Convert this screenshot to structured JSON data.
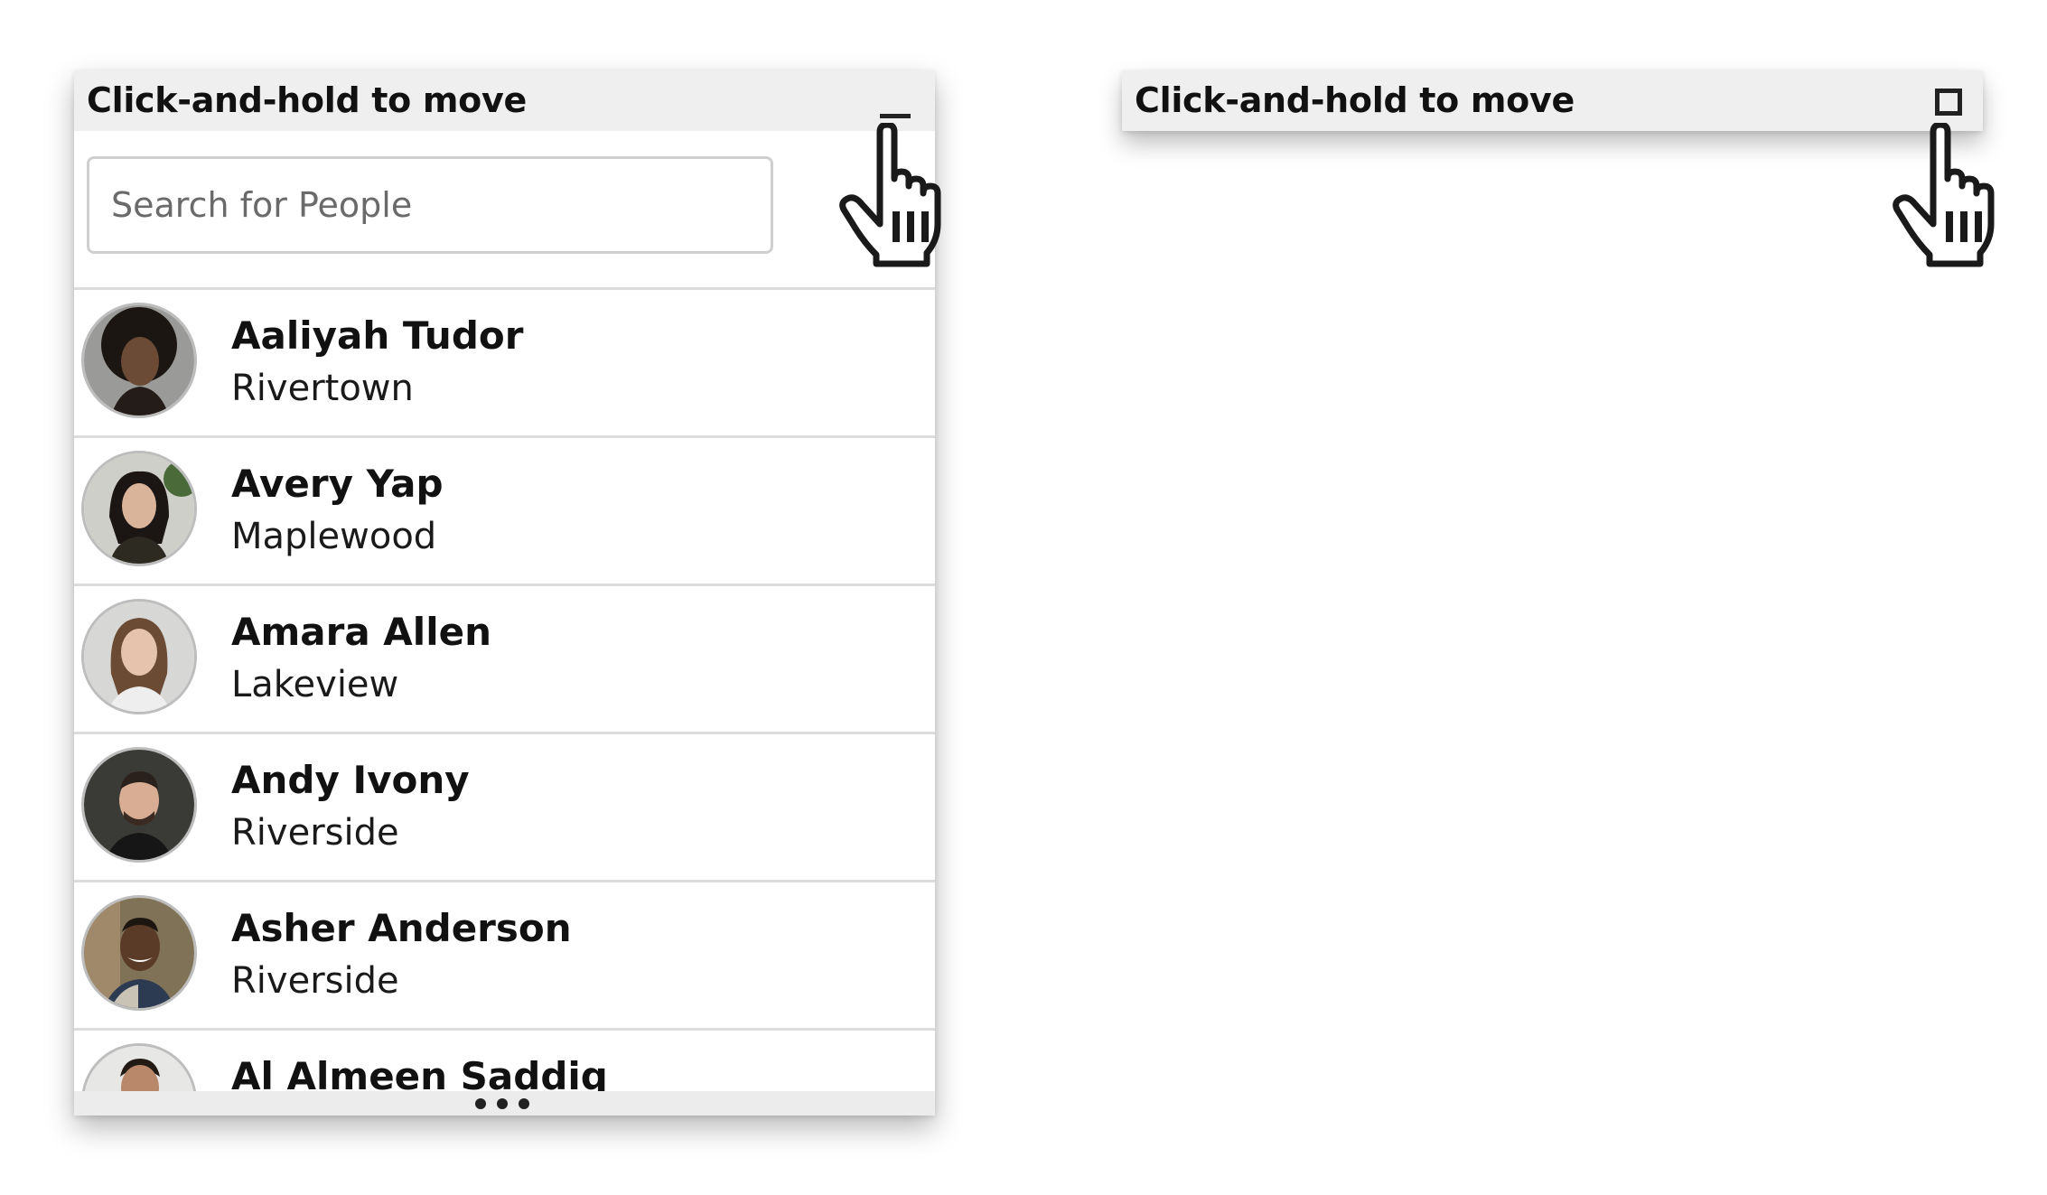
{
  "expanded_panel": {
    "title": "Click-and-hold to move",
    "minimize_icon": "minimize-icon",
    "search": {
      "placeholder": "Search for People",
      "value": ""
    },
    "people": [
      {
        "name": "Aaliyah Tudor",
        "location": "Rivertown",
        "avatar": "avatar-photo"
      },
      {
        "name": "Avery Yap",
        "location": "Maplewood",
        "avatar": "avatar-photo"
      },
      {
        "name": "Amara Allen",
        "location": "Lakeview",
        "avatar": "avatar-photo"
      },
      {
        "name": "Andy Ivony",
        "location": "Riverside",
        "avatar": "avatar-photo"
      },
      {
        "name": "Asher Anderson",
        "location": "Riverside",
        "avatar": "avatar-photo"
      },
      {
        "name": "Al Almeen Saddiq",
        "location": "",
        "avatar": "avatar-photo"
      }
    ],
    "resize_handle_icon": "more-horizontal-icon"
  },
  "collapsed_panel": {
    "title": "Click-and-hold to move",
    "restore_icon": "restore-square-icon"
  },
  "cursor_icon": "pointer-hand-icon",
  "colors": {
    "titlebar_bg": "#efefef",
    "divider": "#dcdcdc",
    "text": "#111111",
    "placeholder": "#6a6a6a"
  }
}
